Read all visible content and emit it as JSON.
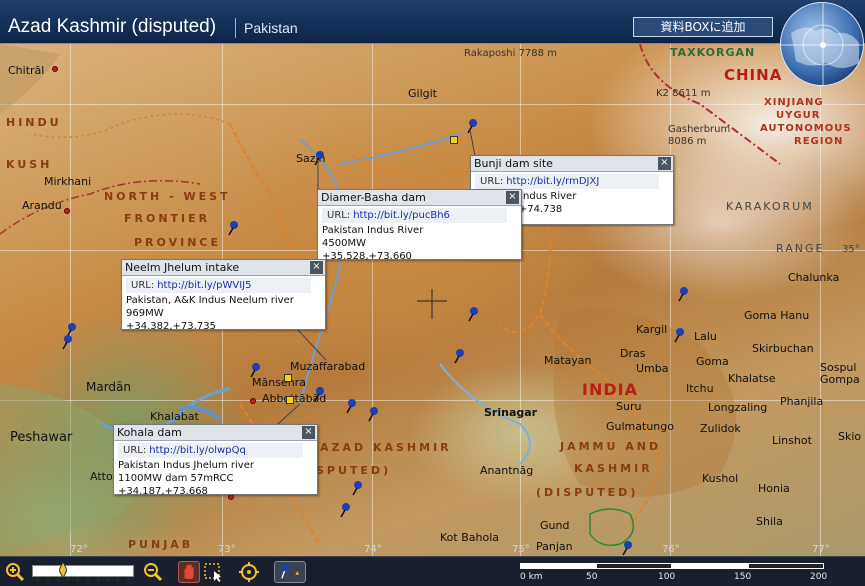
{
  "header": {
    "title": "Azad Kashmir (disputed)",
    "subtitle": "Pakistan",
    "add_button_label": "資料BOXに追加"
  },
  "map": {
    "places": [
      "Chitrāl",
      "Gilgit",
      "Mirkhani",
      "Arandu",
      "Sazin",
      "Muzaffarabad",
      "Mānsehra",
      "Abbottābād",
      "Khalabat",
      "Peshawar",
      "Mardān",
      "Attock",
      "Kargil",
      "Lalu",
      "Dras",
      "Umba",
      "Matayan",
      "Goma",
      "Itchu",
      "Khalatse",
      "Skirbuchan",
      "Sospul Gompa",
      "Chalunka",
      "Goma Hanu",
      "Phanjila",
      "Longzaling",
      "Suru",
      "Gulmatungo",
      "Zulidok",
      "Linshot",
      "Skio",
      "Kushol",
      "Honia",
      "Shila",
      "Srinagar",
      "Anantnāg",
      "Gund",
      "Panjan",
      "Kot Bahola"
    ],
    "peaks": [
      "Rakaposhi 7788 m",
      "K2 8611 m",
      "Gasherbrum 8086 m"
    ],
    "regions": {
      "hindu": "HINDU",
      "kush": "KUSH",
      "nwfp_1": "NORTH - WEST",
      "nwfp_2": "FRONTIER",
      "nwfp_3": "PROVINCE",
      "azad_kashmir": "AZAD KASHMIR",
      "disputed_left": "SPUTED)",
      "jk_1": "JAMMU AND",
      "jk_2": "KASHMIR",
      "jk_3": "(DISPUTED)",
      "punjab": "PUNJAB",
      "china": "CHINA",
      "india": "INDIA",
      "xinjiang_1": "XINJIANG",
      "xinjiang_2": "UYGUR",
      "xinjiang_3": "AUTONOMOUS",
      "xinjiang_4": "REGION",
      "taxkorgan": "TAXKORGAN",
      "karakorum": "KARAKORUM",
      "range": "RANGE"
    },
    "grid_labels": {
      "bottom": [
        "72°",
        "73°",
        "74°",
        "75°",
        "76°",
        "77°"
      ],
      "right": [
        "35°"
      ]
    }
  },
  "popups": [
    {
      "title": "Bunji dam site",
      "url_label": "URL:",
      "url": "http://bit.ly/rmDJXJ",
      "lines": [
        "Pakistan Indus River",
        "+35.6__,+74.738"
      ]
    },
    {
      "title": "Diamer-Basha dam",
      "url_label": "URL:",
      "url": "http://bit.ly/pucBh6",
      "lines": [
        "Pakistan Indus River",
        "4500MW",
        "+35.528,+73.660"
      ]
    },
    {
      "title": "Neelm Jhelum intake",
      "url_label": "URL:",
      "url": "http://bit.ly/pWVIJ5",
      "lines": [
        "Pakistan, A&K Indus Neelum river",
        "969MW",
        "+34.382,+73.735"
      ]
    },
    {
      "title": "Kohala dam",
      "url_label": "URL:",
      "url": "http://bit.ly/olwpQq",
      "lines": [
        "Pakistan Indus Jhelum river",
        "1100MW dam 57mRCC",
        "+34.187,+73.668"
      ]
    }
  ],
  "toolbar": {
    "zoom_level": 0.3,
    "scale_labels": [
      "0 km",
      "50",
      "100",
      "150",
      "200"
    ]
  },
  "colors": {
    "pin": "#1b3fb5",
    "border_line": "#e0822a",
    "title_bg": "#12315c"
  }
}
